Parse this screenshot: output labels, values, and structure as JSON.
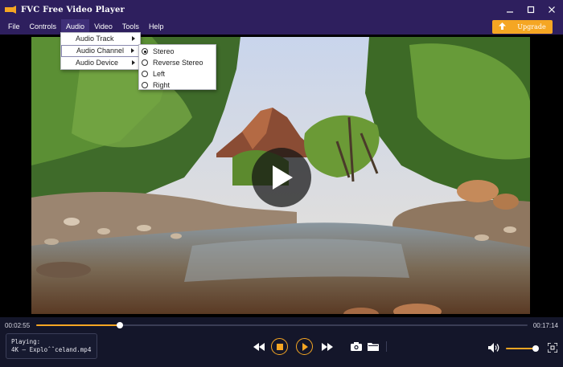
{
  "window": {
    "title": "FVC Free Video Player"
  },
  "menu": {
    "items": [
      {
        "label": "File"
      },
      {
        "label": "Controls"
      },
      {
        "label": "Audio"
      },
      {
        "label": "Video"
      },
      {
        "label": "Tools"
      },
      {
        "label": "Help"
      }
    ],
    "upgrade_label": "Upgrade"
  },
  "audio_menu": {
    "items": [
      {
        "label": "Audio Track"
      },
      {
        "label": "Audio Channel"
      },
      {
        "label": "Audio Device"
      }
    ]
  },
  "audio_channel_menu": {
    "selected": "Stereo",
    "items": [
      {
        "label": "Stereo"
      },
      {
        "label": "Reverse Stereo"
      },
      {
        "label": "Left"
      },
      {
        "label": "Right"
      }
    ]
  },
  "playback": {
    "current_time": "00:02:55",
    "total_time": "00:17:14",
    "progress_fraction": 0.17,
    "now_playing_label": "Playing:",
    "now_playing_file": "4K – Exploˆˆceland.mp4",
    "volume_fraction": 0.92
  },
  "colors": {
    "accent": "#f5a623",
    "titlebar": "#2e1f5e",
    "control_bg": "#14162a"
  },
  "icons": {
    "app": "film-strip-icon",
    "play": "play-icon",
    "rewind": "rewind-icon",
    "stop": "stop-icon",
    "forward": "fast-forward-icon",
    "snapshot": "camera-icon",
    "open": "folder-icon",
    "volume": "speaker-icon",
    "fullscreen": "fullscreen-icon"
  }
}
